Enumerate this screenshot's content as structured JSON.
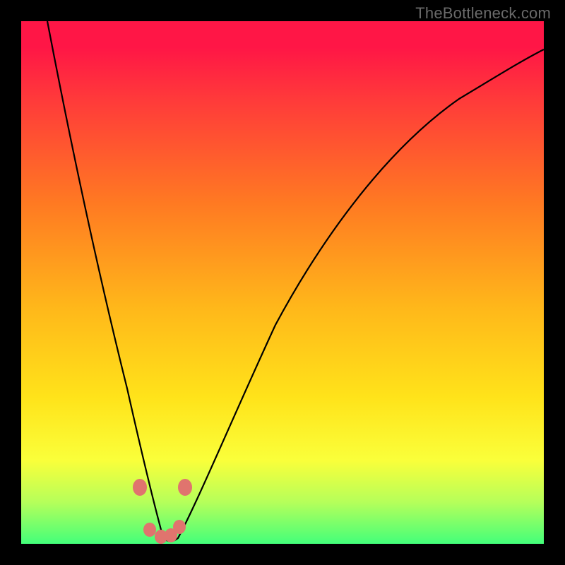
{
  "watermark": "TheBottleneck.com",
  "chart_data": {
    "type": "line",
    "title": "",
    "xlabel": "",
    "ylabel": "",
    "xlim": [
      0,
      100
    ],
    "ylim": [
      0,
      100
    ],
    "notes": "Colored background gradient encodes bottleneck severity (red=high, green=low). Black curve shows bottleneck % vs component balance; minimum ~0% near x≈27. Pink markers highlight near-optimal region.",
    "series": [
      {
        "name": "bottleneck-curve",
        "x": [
          5,
          10,
          15,
          20,
          23,
          25,
          27,
          29,
          31,
          35,
          40,
          45,
          50,
          60,
          70,
          80,
          90,
          100
        ],
        "values": [
          100,
          80,
          55,
          25,
          10,
          3,
          0,
          2,
          8,
          22,
          38,
          50,
          58,
          70,
          78,
          83,
          87,
          90
        ]
      }
    ],
    "markers": [
      {
        "x": 22.5,
        "y": 10
      },
      {
        "x": 31.0,
        "y": 10
      },
      {
        "x": 24.5,
        "y": 2
      },
      {
        "x": 26.5,
        "y": 0
      },
      {
        "x": 28.5,
        "y": 1
      },
      {
        "x": 30.0,
        "y": 3
      }
    ]
  }
}
